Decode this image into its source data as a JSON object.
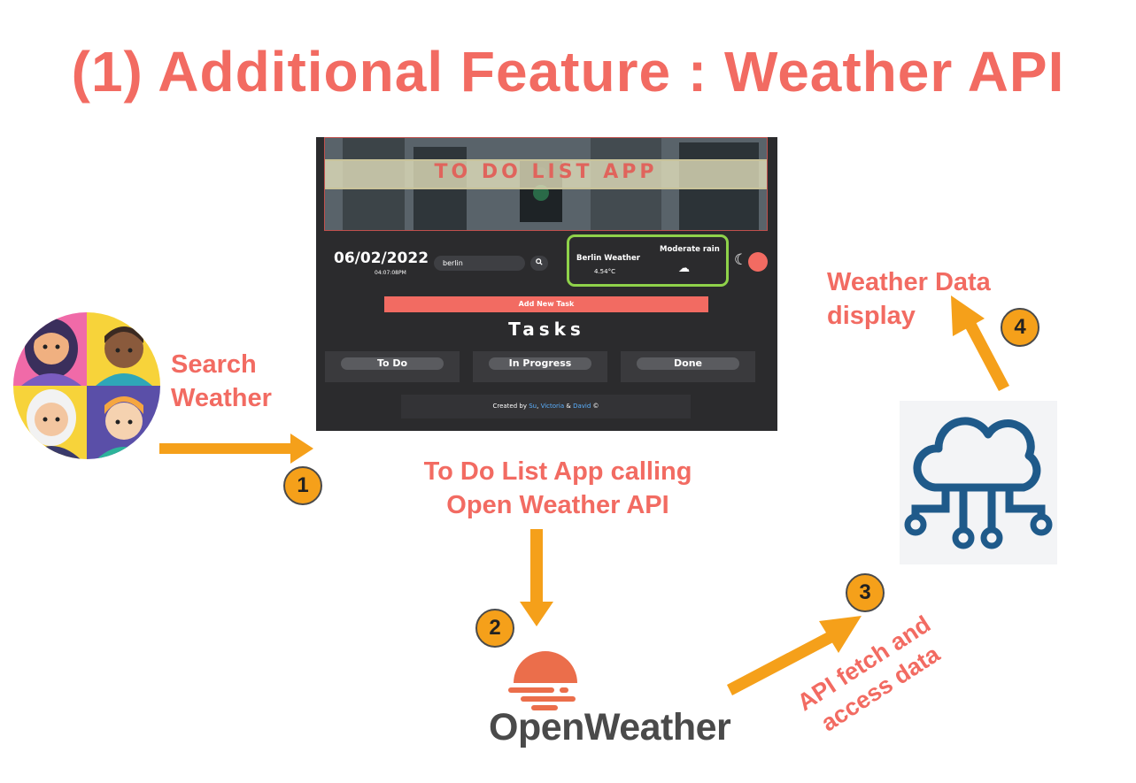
{
  "title": "(1) Additional Feature : Weather API",
  "labels": {
    "search_line1": "Search",
    "search_line2": "Weather",
    "calling_line1": "To Do List App calling",
    "calling_line2": "Open Weather API",
    "fetch_line1": "API fetch and",
    "fetch_line2": "access data",
    "display_line1": "Weather Data",
    "display_line2": "display"
  },
  "steps": [
    "1",
    "2",
    "3",
    "4"
  ],
  "app": {
    "title": "TO DO LIST APP",
    "date": "06/02/2022",
    "time": "04:07:08PM",
    "search_value": "berlin",
    "weather_city": "Berlin Weather",
    "weather_temp": "4.54°C",
    "weather_condition": "Moderate rain",
    "add_button": "Add New Task",
    "tasks_heading": "Tasks",
    "columns": [
      "To Do",
      "In Progress",
      "Done"
    ],
    "footer_prefix": "Created by ",
    "footer_names": [
      "Su",
      "Victoria",
      "David"
    ],
    "footer_sep1": ", ",
    "footer_sep2": " & ",
    "footer_suffix": " ©"
  },
  "openweather_logo": "OpenWeather",
  "colors": {
    "accent": "#f26b62",
    "arrow": "#f5a01a",
    "app_bg": "#2b2b2d",
    "weather_border": "#8fd24a",
    "cloud_icon": "#1f5a8a"
  },
  "icons": [
    "user-avatars-icon",
    "cloud-network-icon",
    "openweather-sun-icon",
    "search-icon",
    "moon-icon",
    "cloud-icon"
  ]
}
